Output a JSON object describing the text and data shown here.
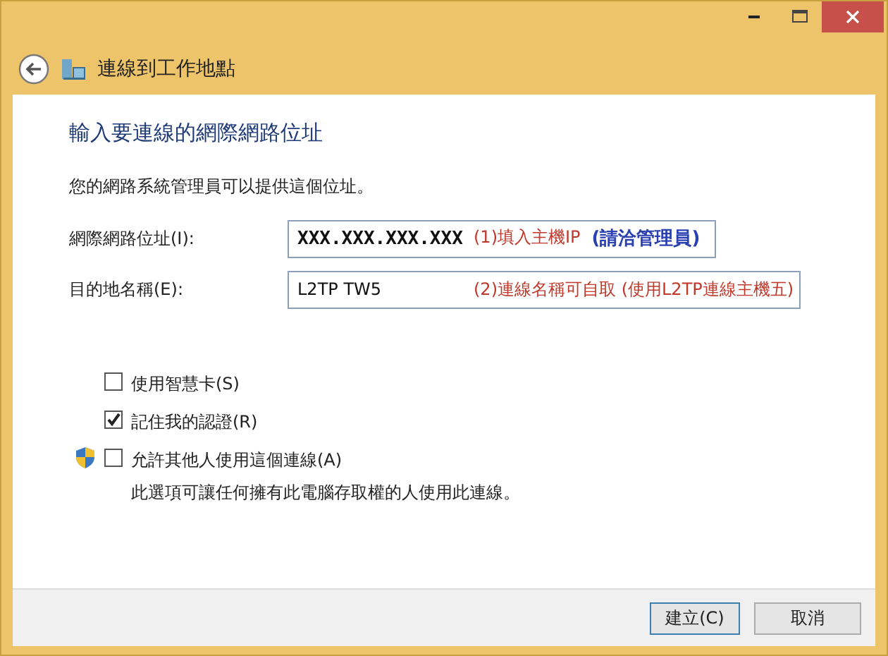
{
  "window": {
    "title": "連線到工作地點"
  },
  "heading": "輸入要連線的網際網路位址",
  "description": "您的網路系統管理員可以提供這個位址。",
  "fields": [
    {
      "label": "網際網路位址(I):",
      "value": "XXX.XXX.XXX.XXX",
      "annotations": [
        {
          "text": "(1)填入主機IP",
          "color": "#c0392b"
        },
        {
          "text": "(請洽管理員)",
          "color": "#2a3fb0"
        }
      ]
    },
    {
      "label": "目的地名稱(E):",
      "value": "L2TP TW5",
      "annotations": [
        {
          "text": "(2)連線名稱可自取 (使用L2TP連線主機五)",
          "color": "#c0392b"
        }
      ]
    }
  ],
  "options": [
    {
      "label": "使用智慧卡(S)",
      "checked": false,
      "shield": false
    },
    {
      "label": "記住我的認證(R)",
      "checked": true,
      "shield": false
    },
    {
      "label": "允許其他人使用這個連線(A)",
      "checked": false,
      "shield": true,
      "note": "此選項可讓任何擁有此電腦存取權的人使用此連線。"
    }
  ],
  "buttons": [
    {
      "label": "建立(C)",
      "default": true
    },
    {
      "label": "取消",
      "default": false
    }
  ]
}
